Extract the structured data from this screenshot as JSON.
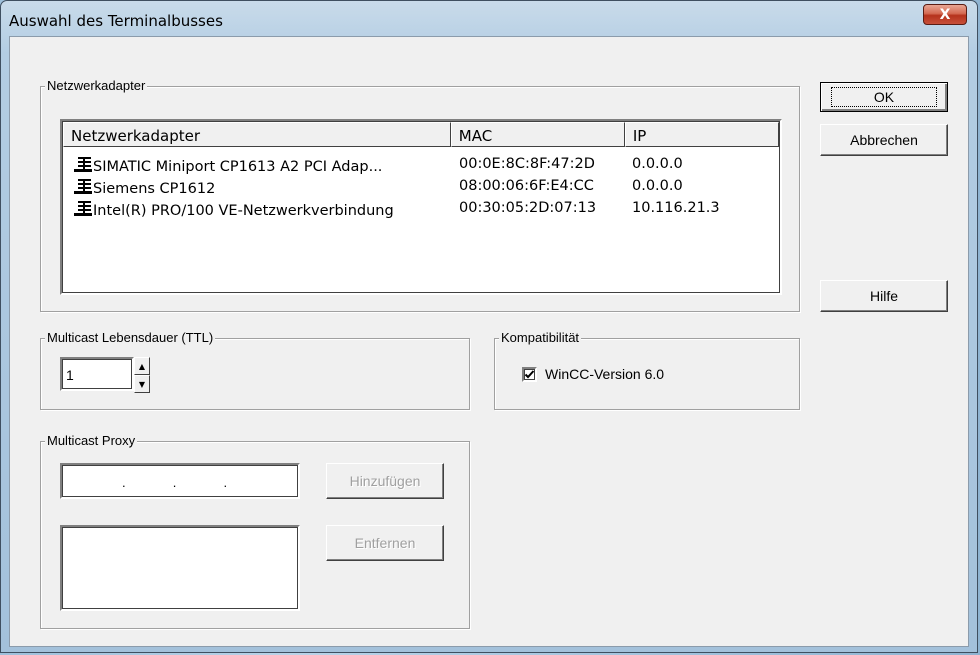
{
  "window": {
    "title": "Auswahl des Terminalbusses",
    "close_label": "X"
  },
  "adapters": {
    "group_label": "Netzwerkadapter",
    "columns": [
      "Netzwerkadapter",
      "MAC",
      "IP"
    ],
    "rows": [
      {
        "name": "SIMATIC Miniport CP1613 A2 PCI Adap...",
        "mac": "00:0E:8C:8F:47:2D",
        "ip": "0.0.0.0"
      },
      {
        "name": "Siemens CP1612",
        "mac": "08:00:06:6F:E4:CC",
        "ip": "0.0.0.0"
      },
      {
        "name": "Intel(R) PRO/100 VE-Netzwerkverbindung",
        "mac": "00:30:05:2D:07:13",
        "ip": "10.116.21.3"
      }
    ],
    "row_icon": "network-adapter-icon"
  },
  "buttons": {
    "ok": "OK",
    "cancel": "Abbrechen",
    "help": "Hilfe",
    "add": "Hinzufügen",
    "remove": "Entfernen"
  },
  "ttl": {
    "group_label": "Multicast Lebensdauer (TTL)",
    "value": "1"
  },
  "compat": {
    "group_label": "Kompatibilität",
    "checkbox_label": "WinCC-Version 6.0",
    "checked": true
  },
  "proxy": {
    "group_label": "Multicast Proxy",
    "ip_placeholder": ".          .          ."
  }
}
